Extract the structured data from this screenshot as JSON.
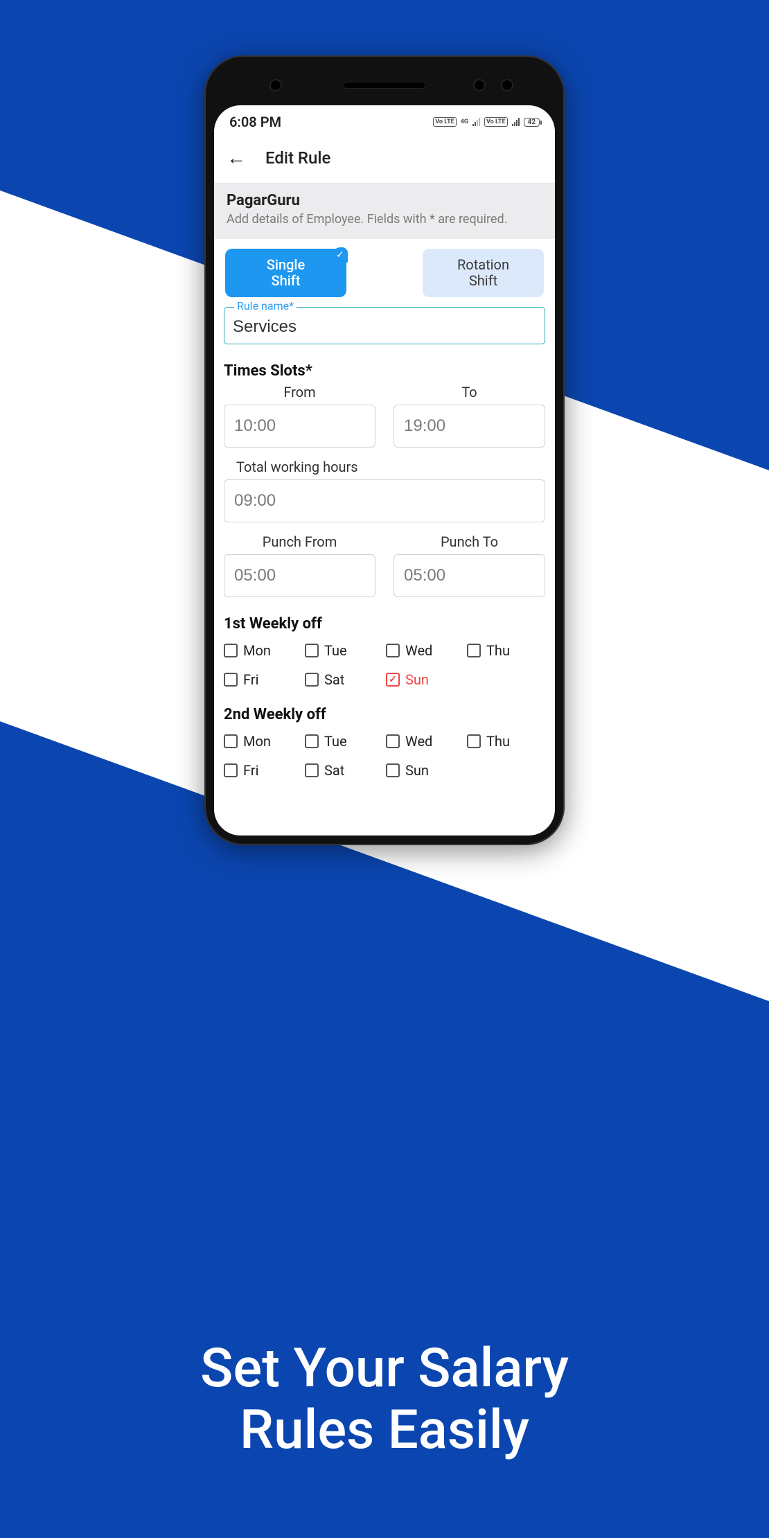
{
  "promo_tagline": "Set Your Salary\nRules Easily",
  "status": {
    "time": "6:08 PM",
    "volte1": "Vo LTE",
    "net1": "4G",
    "volte2": "Vo LTE",
    "battery": "42"
  },
  "header": {
    "title": "Edit Rule"
  },
  "subhead": {
    "title": "PagarGuru",
    "description": "Add details of Employee. Fields with * are required."
  },
  "tabs": {
    "single": "Single\nShift",
    "rotation": "Rotation\nShift"
  },
  "rule": {
    "legend": "Rule name*",
    "value": "Services"
  },
  "timeslots": {
    "title": "Times Slots*",
    "from_label": "From",
    "from_value": "10:00",
    "to_label": "To",
    "to_value": "19:00",
    "twh_label": "Total working hours",
    "twh_value": "09:00",
    "pfrom_label": "Punch From",
    "pfrom_value": "05:00",
    "pto_label": "Punch To",
    "pto_value": "05:00"
  },
  "week1": {
    "title": "1st Weekly off",
    "days": [
      "Mon",
      "Tue",
      "Wed",
      "Thu",
      "Fri",
      "Sat",
      "Sun"
    ],
    "checked": [
      false,
      false,
      false,
      false,
      false,
      false,
      true
    ]
  },
  "week2": {
    "title": "2nd Weekly off",
    "days": [
      "Mon",
      "Tue",
      "Wed",
      "Thu",
      "Fri",
      "Sat",
      "Sun"
    ],
    "checked": [
      false,
      false,
      false,
      false,
      false,
      false,
      false
    ]
  }
}
